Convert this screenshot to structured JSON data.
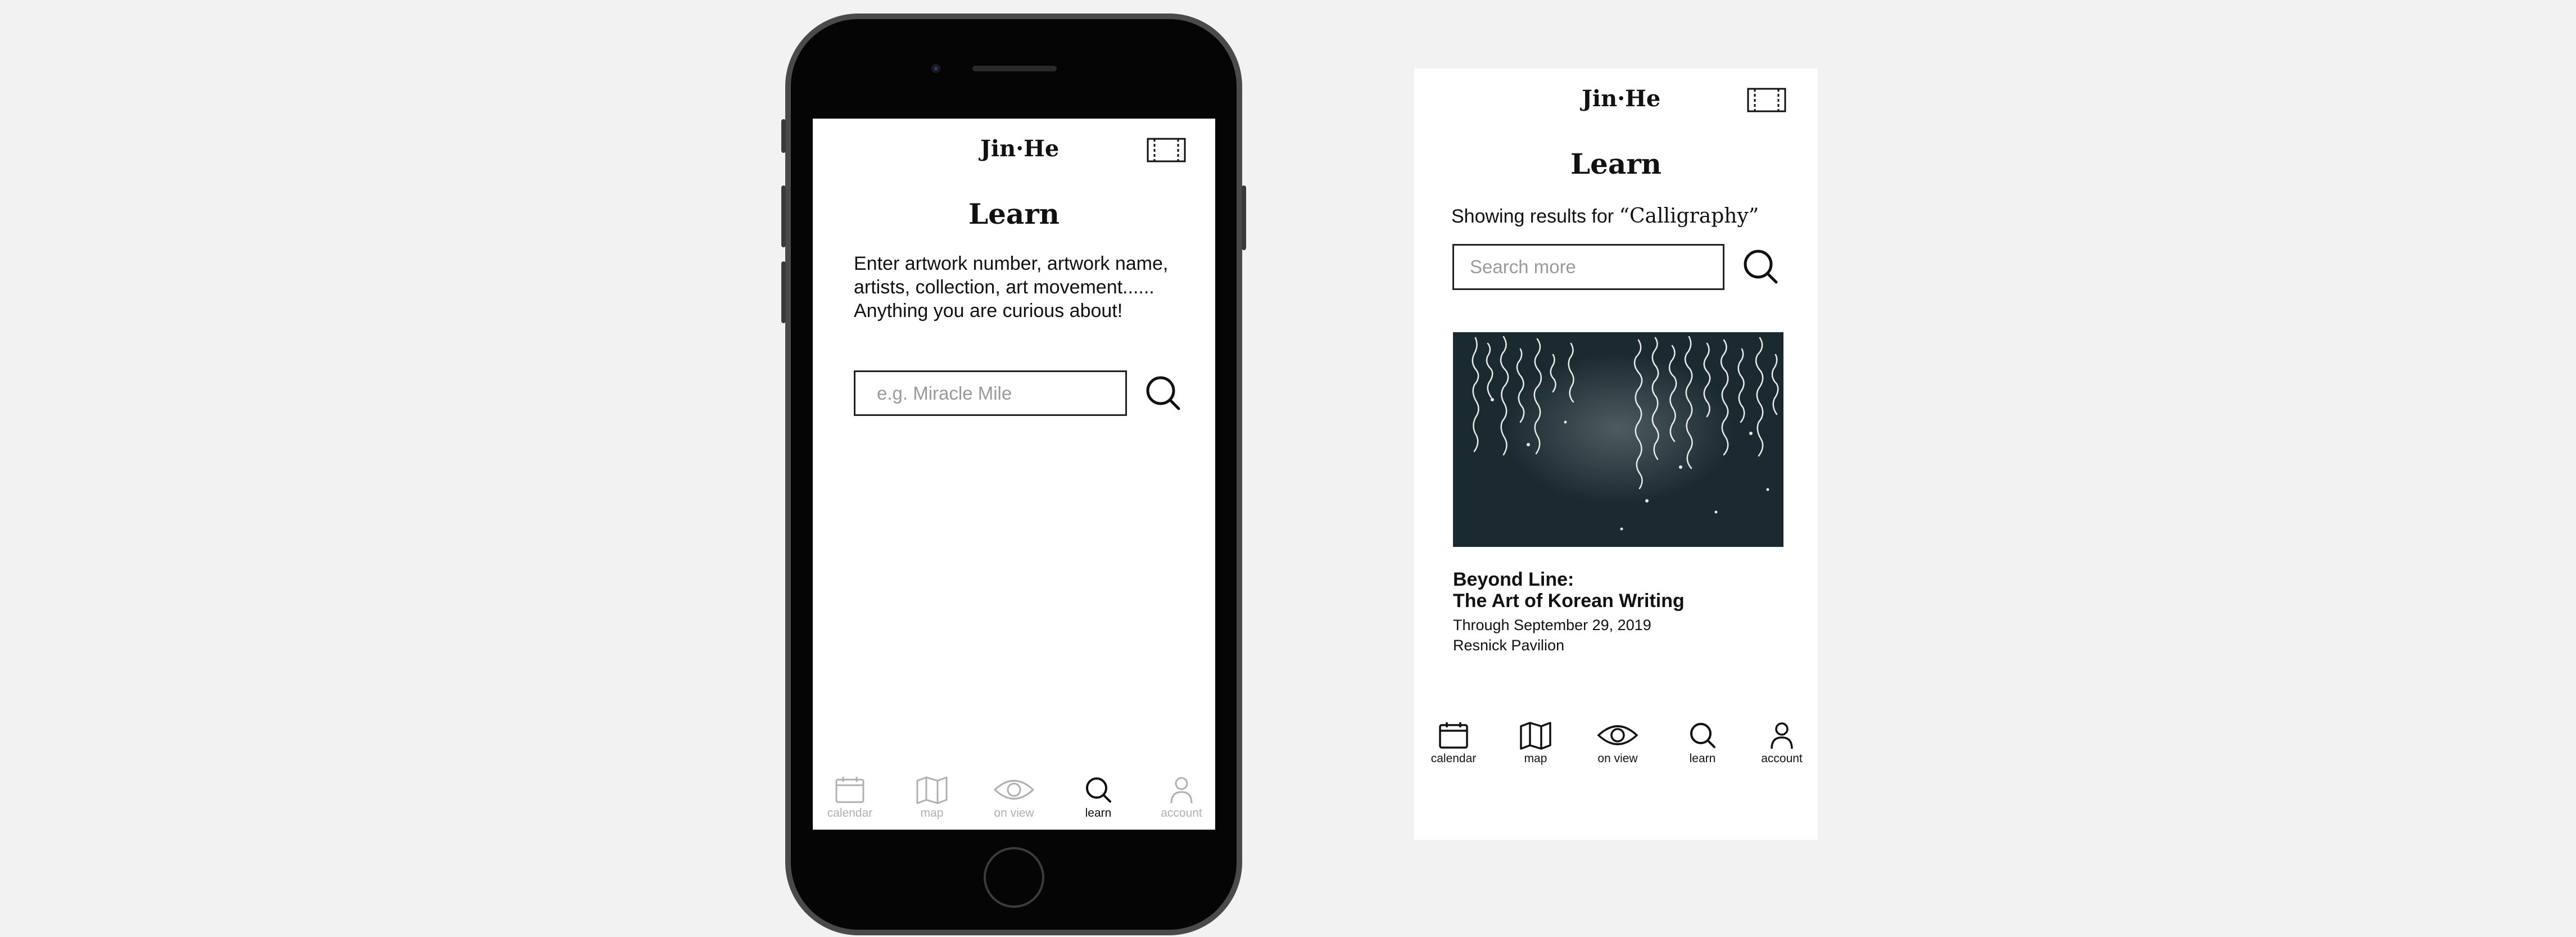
{
  "colors": {
    "background": "#f2f2f2",
    "screen": "#ffffff",
    "text": "#111111",
    "nav_inactive": "#b0b0b0",
    "placeholder": "#9a9a9a",
    "image_bg": "#1b2a31"
  },
  "brand": {
    "logo": "Jin·He"
  },
  "phone_screen": {
    "title": "Learn",
    "description": "Enter artwork number, artwork name, artists, collection, art movement...... Anything you are curious about!",
    "search": {
      "placeholder": "e.g. Miracle Mile",
      "value": ""
    },
    "active_tab": "learn"
  },
  "results_screen": {
    "title": "Learn",
    "results_prefix": "Showing results for ",
    "query": "“Calligraphy”",
    "search": {
      "placeholder": "Search more",
      "value": ""
    },
    "result": {
      "image_icon": "calligraphy-artwork-image",
      "title_line1": "Beyond Line:",
      "title_line2": "The Art of Korean Writing",
      "dates": "Through September 29, 2019",
      "location": "Resnick Pavilion"
    }
  },
  "nav": [
    {
      "key": "calendar",
      "label": "calendar",
      "icon": "calendar-icon"
    },
    {
      "key": "map",
      "label": "map",
      "icon": "map-icon"
    },
    {
      "key": "on_view",
      "label": "on view",
      "icon": "eye-icon"
    },
    {
      "key": "learn",
      "label": "learn",
      "icon": "search-icon"
    },
    {
      "key": "account",
      "label": "account",
      "icon": "user-icon"
    }
  ]
}
